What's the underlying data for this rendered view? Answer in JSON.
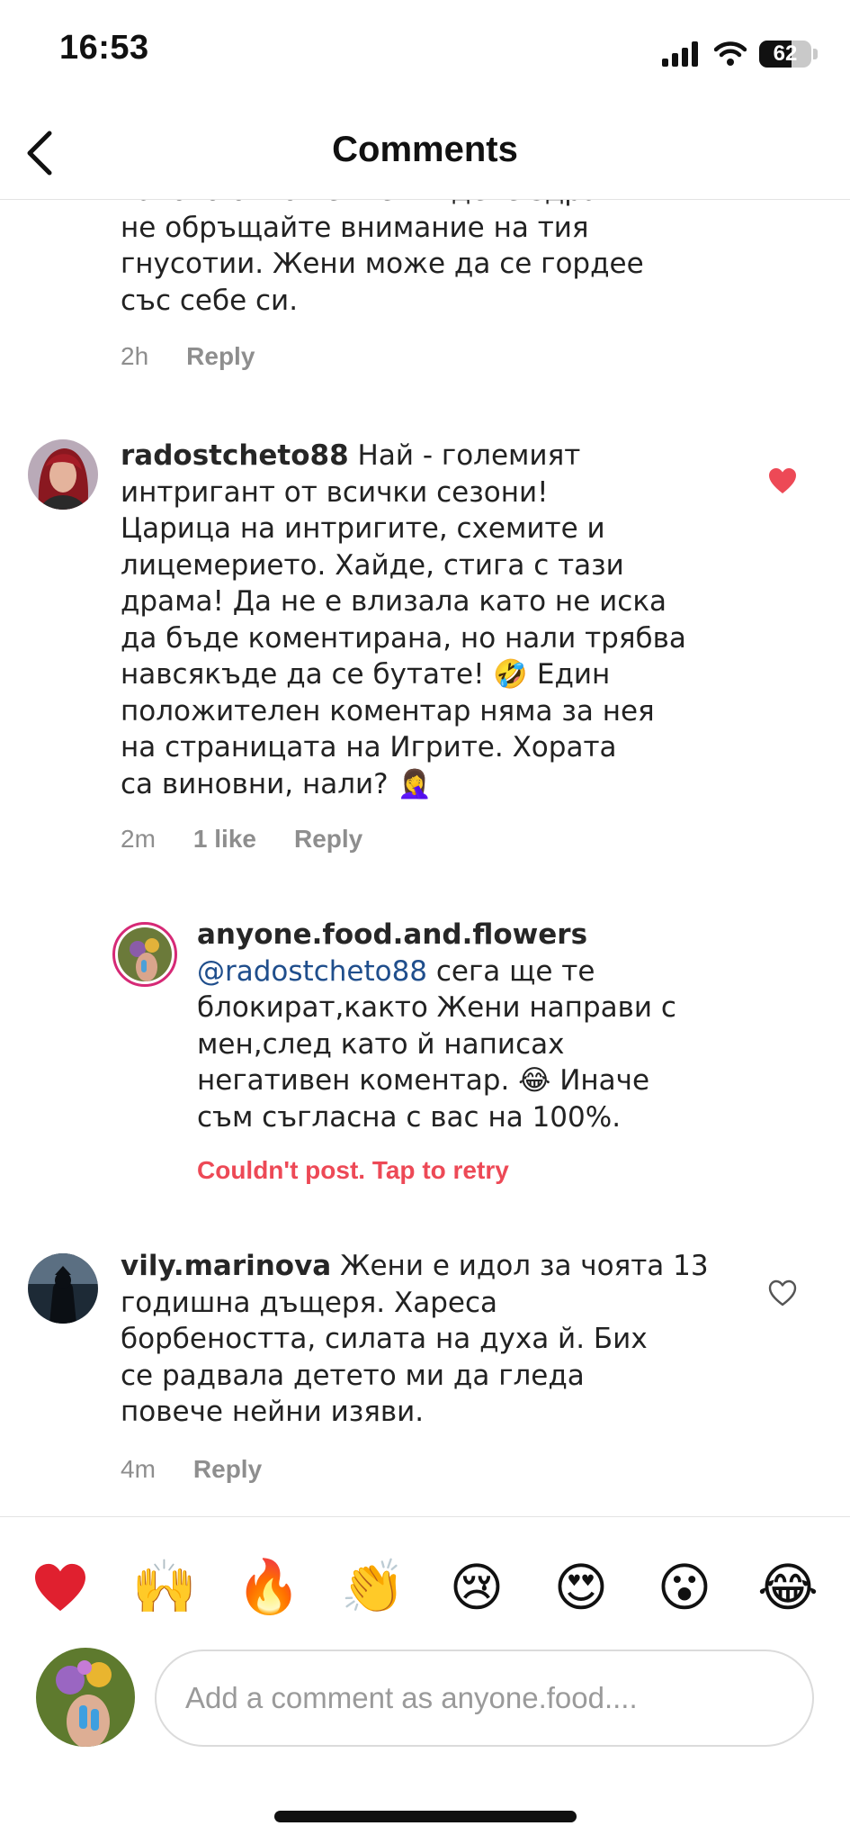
{
  "status_bar": {
    "time": "16:53",
    "battery": "62",
    "battery_level": 0.62
  },
  "header": {
    "title": "Comments"
  },
  "top_comment": {
    "lines": [
      "таково отношение. Бъдете здрави и",
      "не обръщайте внимание на тия",
      "гнусотии. Жени може да се гордее",
      "със себе си."
    ],
    "time": "2h",
    "reply_label": "Reply"
  },
  "comments": [
    {
      "username": "radostcheto88",
      "lines": [
        " Най - големият",
        "интригант от всички сезони!",
        "Царица на интригите, схемите и",
        "лицемерието. Хайде, стига с тази",
        "драма! Да не е влизала като не иска",
        "да бъде коментирана, но нали трябва",
        "навсякъде да се бутате! 🤣 Един",
        "положителен коментар няма за нея",
        "на страницата на Игрите. Хората",
        "са виновни, нали? 🤦‍♀️"
      ],
      "time": "2m",
      "likes": "1 like",
      "reply_label": "Reply",
      "liked": true
    },
    {
      "username": "vily.marinova",
      "lines": [
        " Жени е идол за чоята 13",
        "годишна дъщеря. Хареса",
        "борбеността, силата на духа й. Бих",
        "се радвала детето ми да гледа",
        "повече нейни изяви."
      ],
      "time": "4m",
      "reply_label": "Reply",
      "liked": false
    }
  ],
  "reply": {
    "username": "anyone.food.and.flowers",
    "mention": "@radostcheto88",
    "lines": [
      " сега ще те",
      "блокират,както Жени направи с",
      "мен,след като й написах",
      "негативен коментар. 😂 Иначе",
      "съм съгласна с вас на 100%."
    ],
    "error": "Couldn't post. Tap to retry"
  },
  "emoji_bar": [
    "❤️",
    "🙌",
    "🔥",
    "👏",
    "😢",
    "😍",
    "😮",
    "😂"
  ],
  "input": {
    "placeholder": "Add a comment as anyone.food...."
  },
  "colors": {
    "heart_red": "#ed4956",
    "error_red": "#ed4956",
    "mention_blue": "#1f4e8c",
    "meta_gray": "#8e8e8e"
  }
}
